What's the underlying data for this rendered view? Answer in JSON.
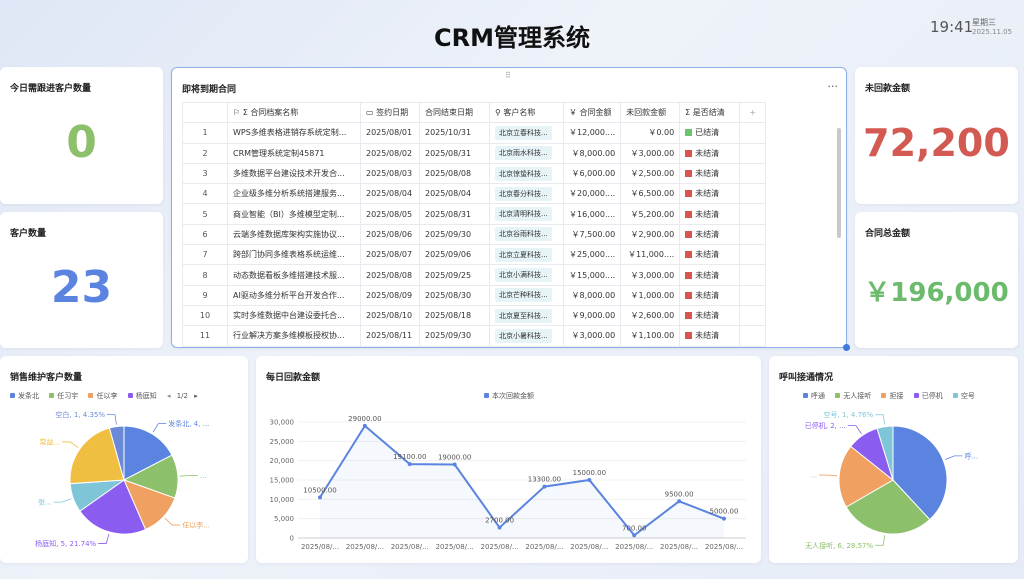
{
  "title": "CRM管理系统",
  "clock": {
    "time": "19:41",
    "weekday": "星期三",
    "date": "2025.11.05"
  },
  "kpis": {
    "followup": {
      "label": "今日需跟进客户数量",
      "value": "0",
      "color": "#8cc06a"
    },
    "customers": {
      "label": "客户数量",
      "value": "23",
      "color": "#5b84e0"
    },
    "unpaid": {
      "label": "未回款金额",
      "value": "72,200",
      "color": "#d35a52"
    },
    "total": {
      "label": "合同总金额",
      "value": "￥196,000",
      "color": "#6cba6c"
    }
  },
  "contracts": {
    "title": "即将到期合同",
    "more_icon": "more-icon",
    "headers": [
      "合同档案名称",
      "签约日期",
      "合同结束日期",
      "客户名称",
      "合同金额",
      "未回款金额",
      "是否结清"
    ],
    "status_colors": {
      "已结清": "#6cc46c",
      "未结清": "#d9534f"
    },
    "rows": [
      [
        "1",
        "WPS多维表格进销存系统定制...",
        "2025/08/01",
        "2025/10/31",
        "北京立春科技...",
        "￥12,000....",
        "￥0.00",
        "已结清"
      ],
      [
        "2",
        "CRM管理系统定制45871",
        "2025/08/02",
        "2025/08/31",
        "北京雨水科技...",
        "￥8,000.00",
        "￥3,000.00",
        "未结清"
      ],
      [
        "3",
        "多维数据平台建设技术开发合...",
        "2025/08/03",
        "2025/08/08",
        "北京惊蛰科技...",
        "￥6,000.00",
        "￥2,500.00",
        "未结清"
      ],
      [
        "4",
        "企业级多维分析系统搭建服务...",
        "2025/08/04",
        "2025/08/04",
        "北京春分科技...",
        "￥20,000....",
        "￥6,500.00",
        "未结清"
      ],
      [
        "5",
        "商业智能（BI）多维模型定制...",
        "2025/08/05",
        "2025/08/31",
        "北京清明科技...",
        "￥16,000....",
        "￥5,200.00",
        "未结清"
      ],
      [
        "6",
        "云端多维数据库架构实施协议...",
        "2025/08/06",
        "2025/09/30",
        "北京谷雨科技...",
        "￥7,500.00",
        "￥2,900.00",
        "未结清"
      ],
      [
        "7",
        "跨部门协同多维表格系统运维...",
        "2025/08/07",
        "2025/09/06",
        "北京立夏科技...",
        "￥25,000....",
        "￥11,000....",
        "未结清"
      ],
      [
        "8",
        "动态数据看板多维搭建技术服...",
        "2025/08/08",
        "2025/09/25",
        "北京小满科技...",
        "￥15,000....",
        "￥3,000.00",
        "未结清"
      ],
      [
        "9",
        "AI驱动多维分析平台开发合作...",
        "2025/08/09",
        "2025/08/30",
        "北京芒种科技...",
        "￥8,000.00",
        "￥1,000.00",
        "未结清"
      ],
      [
        "10",
        "实时多维数据中台建设委托合...",
        "2025/08/10",
        "2025/08/18",
        "北京夏至科技...",
        "￥9,000.00",
        "￥2,600.00",
        "未结清"
      ],
      [
        "11",
        "行业解决方案多维模板授权协...",
        "2025/08/11",
        "2025/09/30",
        "北京小暑科技...",
        "￥3,000.00",
        "￥1,100.00",
        "未结清"
      ]
    ]
  },
  "sales_pie": {
    "title": "销售维护客户数量",
    "legend": [
      "发条北",
      "任习宇",
      "任以李",
      "杨庭知"
    ],
    "pager": "1/2",
    "labels": {
      "a": "发条北, 4, ...",
      "b": "...",
      "c": "任以李...",
      "d": "杨庭知, 5, 21.74%",
      "e": "张...",
      "f": "常益...",
      "g": "空白, 1, 4.35%"
    }
  },
  "chart_data": [
    {
      "type": "pie",
      "title": "销售维护客户数量",
      "legend_placement": "top",
      "slices": [
        {
          "name": "发条北",
          "value": 4,
          "color": "#5b84e0"
        },
        {
          "name": "任习宇",
          "value": 3,
          "color": "#8cc06a"
        },
        {
          "name": "任以李",
          "value": 3,
          "color": "#f0a060"
        },
        {
          "name": "杨庭知",
          "value": 5,
          "color": "#8b5cf0"
        },
        {
          "name": "张",
          "value": 2,
          "color": "#7ec5d8"
        },
        {
          "name": "常益",
          "value": 5,
          "color": "#f0be40"
        },
        {
          "name": "空白",
          "value": 1,
          "color": "#6a8ad8"
        }
      ]
    },
    {
      "type": "line",
      "title": "每日回款金额",
      "series": [
        {
          "name": "本次回款金额",
          "values": [
            10500,
            29000,
            19100,
            19000,
            2700,
            13300,
            15000,
            700,
            9500,
            5000
          ],
          "color": "#5b84e0"
        }
      ],
      "x_tick_labels": [
        "2025/08/...",
        "2025/08/...",
        "2025/08/...",
        "2025/08/...",
        "2025/08/...",
        "2025/08/...",
        "2025/08/...",
        "2025/08/...",
        "2025/08/...",
        "2025/08/..."
      ],
      "data_labels": [
        "10500.00",
        "29000.00",
        "19100.00",
        "19000.00",
        "2700.00",
        "13300.00",
        "15000.00",
        "700.00",
        "9500.00",
        "5000.00"
      ],
      "yticks": [
        "0",
        "5,000",
        "10,000",
        "15,000",
        "20,000",
        "25,000",
        "30,000"
      ],
      "ylim": [
        0,
        30000
      ],
      "grid": true
    },
    {
      "type": "pie",
      "title": "呼叫接通情况",
      "legend_placement": "top",
      "slices": [
        {
          "name": "呼通",
          "value": 8,
          "color": "#5b84e0"
        },
        {
          "name": "无人接听",
          "value": 6,
          "color": "#8cc06a"
        },
        {
          "name": "拒接",
          "value": 4,
          "color": "#f0a060"
        },
        {
          "name": "已停机",
          "value": 2,
          "color": "#8b5cf0"
        },
        {
          "name": "空号",
          "value": 1,
          "color": "#7ec5d8"
        }
      ]
    }
  ],
  "call_pie": {
    "title": "呼叫接通情况",
    "legend": [
      "呼通",
      "无人接听",
      "拒接",
      "已停机",
      "空号"
    ],
    "labels": {
      "a": "呼...",
      "b": "无人接听, 6, 28.57%",
      "c": "...",
      "d": "已停机, 2, ...",
      "e": "空号, 1, 4.76%"
    }
  },
  "line": {
    "title": "每日回款金额",
    "legend": "本次回款金额"
  }
}
